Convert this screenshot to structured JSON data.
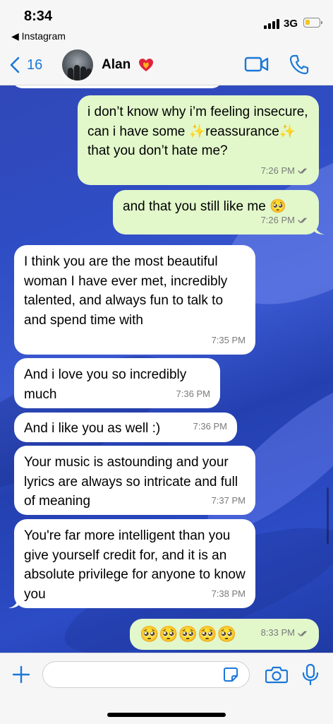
{
  "status_bar": {
    "time": "8:34",
    "back_app": "◀ Instagram",
    "network": "3G",
    "battery_color": "#f3c623"
  },
  "header": {
    "back_count": "16",
    "contact_name": "Alan",
    "accent": "#1a78d8"
  },
  "messages": [
    {
      "direction": "out",
      "text": "i don’t know why i’m feeling insecure, can i have some ✨reassurance✨ that you don’t hate me?",
      "time": "7:26 PM",
      "read": true
    },
    {
      "direction": "out",
      "text": "and that you still like me 🥺",
      "time": "7:26 PM",
      "read": true
    },
    {
      "direction": "in",
      "text": "I think you are the most beautiful woman I have ever met, incredibly talented, and always fun to talk to and spend time with",
      "time": "7:35 PM"
    },
    {
      "direction": "in",
      "text": "And i love you so incredibly much",
      "time": "7:36 PM"
    },
    {
      "direction": "in",
      "text": "And i like you as well :)",
      "time": "7:36 PM"
    },
    {
      "direction": "in",
      "text": "Your music is astounding and your lyrics are always so intricate and full of meaning",
      "time": "7:37 PM"
    },
    {
      "direction": "in",
      "text": "You're far more intelligent than you give yourself credit for, and it is an absolute privilege for anyone to know you",
      "time": "7:38 PM"
    },
    {
      "direction": "out",
      "text": "🥺🥺🥺🥺🥺",
      "time": "8:33 PM",
      "read": true
    }
  ],
  "input": {
    "value": "",
    "placeholder": ""
  },
  "colors": {
    "outgoing_bubble": "#e2f8cb",
    "incoming_bubble": "#ffffff",
    "chat_background": "#2f4dc4",
    "read_ticks": "#7a7a7a"
  }
}
